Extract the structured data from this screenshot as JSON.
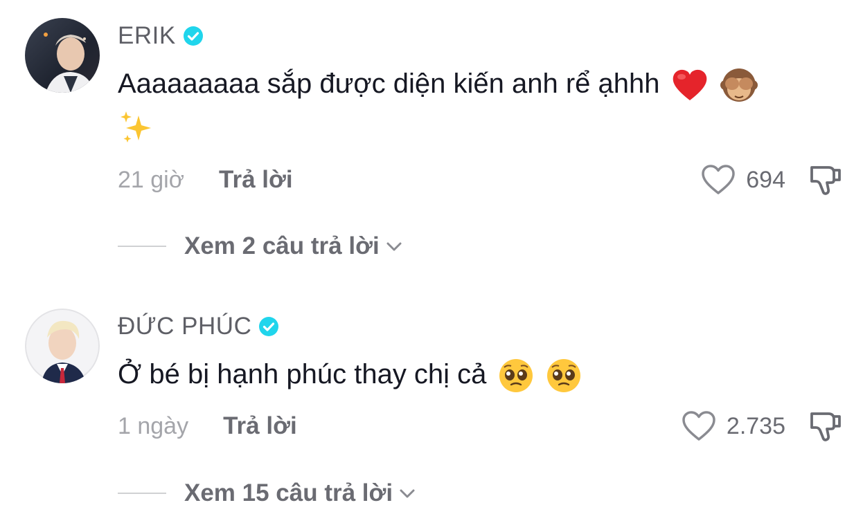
{
  "comments": [
    {
      "username": "ERIK",
      "verified": true,
      "text": "Aaaaaaaaa sắp được diện kiến anh rể ạhhh",
      "emojis": [
        "red-heart",
        "see-no-evil-monkey",
        "sparkles"
      ],
      "time": "21 giờ",
      "reply_label": "Trả lời",
      "likes": "694",
      "view_replies": "Xem 2 câu trả lời"
    },
    {
      "username": "ĐỨC PHÚC",
      "verified": true,
      "text": "Ở bé bị hạnh phúc thay chị cả",
      "emojis": [
        "pleading-face",
        "pleading-face"
      ],
      "time": "1 ngày",
      "reply_label": "Trả lời",
      "likes": "2.735",
      "view_replies": "Xem 15 câu trả lời"
    }
  ],
  "colors": {
    "verified": "#20D5EC",
    "username": "#5E5F66",
    "text": "#161823",
    "secondary": "#A4A5AA"
  }
}
